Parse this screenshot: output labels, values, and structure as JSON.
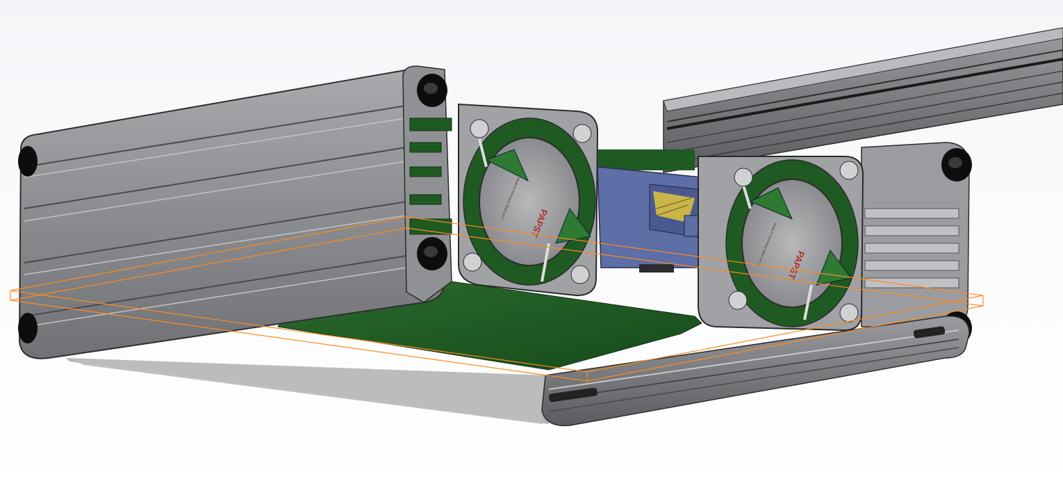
{
  "scene": {
    "type": "3d-cad-viewport",
    "background_colors": [
      "#eef1f5",
      "#ffffff"
    ],
    "colors": {
      "extrusion": "#8d8f92",
      "extrusion_dark": "#5e6064",
      "pcb": "#1f5a23",
      "connector": "#5a6aa0",
      "screw": "#0d0d0d",
      "selection": "#ff8a1e",
      "shadow": "#b8b8b8"
    }
  },
  "fans": [
    {
      "label": "PAPST",
      "fine_print": "Made in Germany  Nidec Art.1"
    },
    {
      "label": "PAPST",
      "fine_print": "Made in Germany  Nidec Art.1"
    }
  ]
}
